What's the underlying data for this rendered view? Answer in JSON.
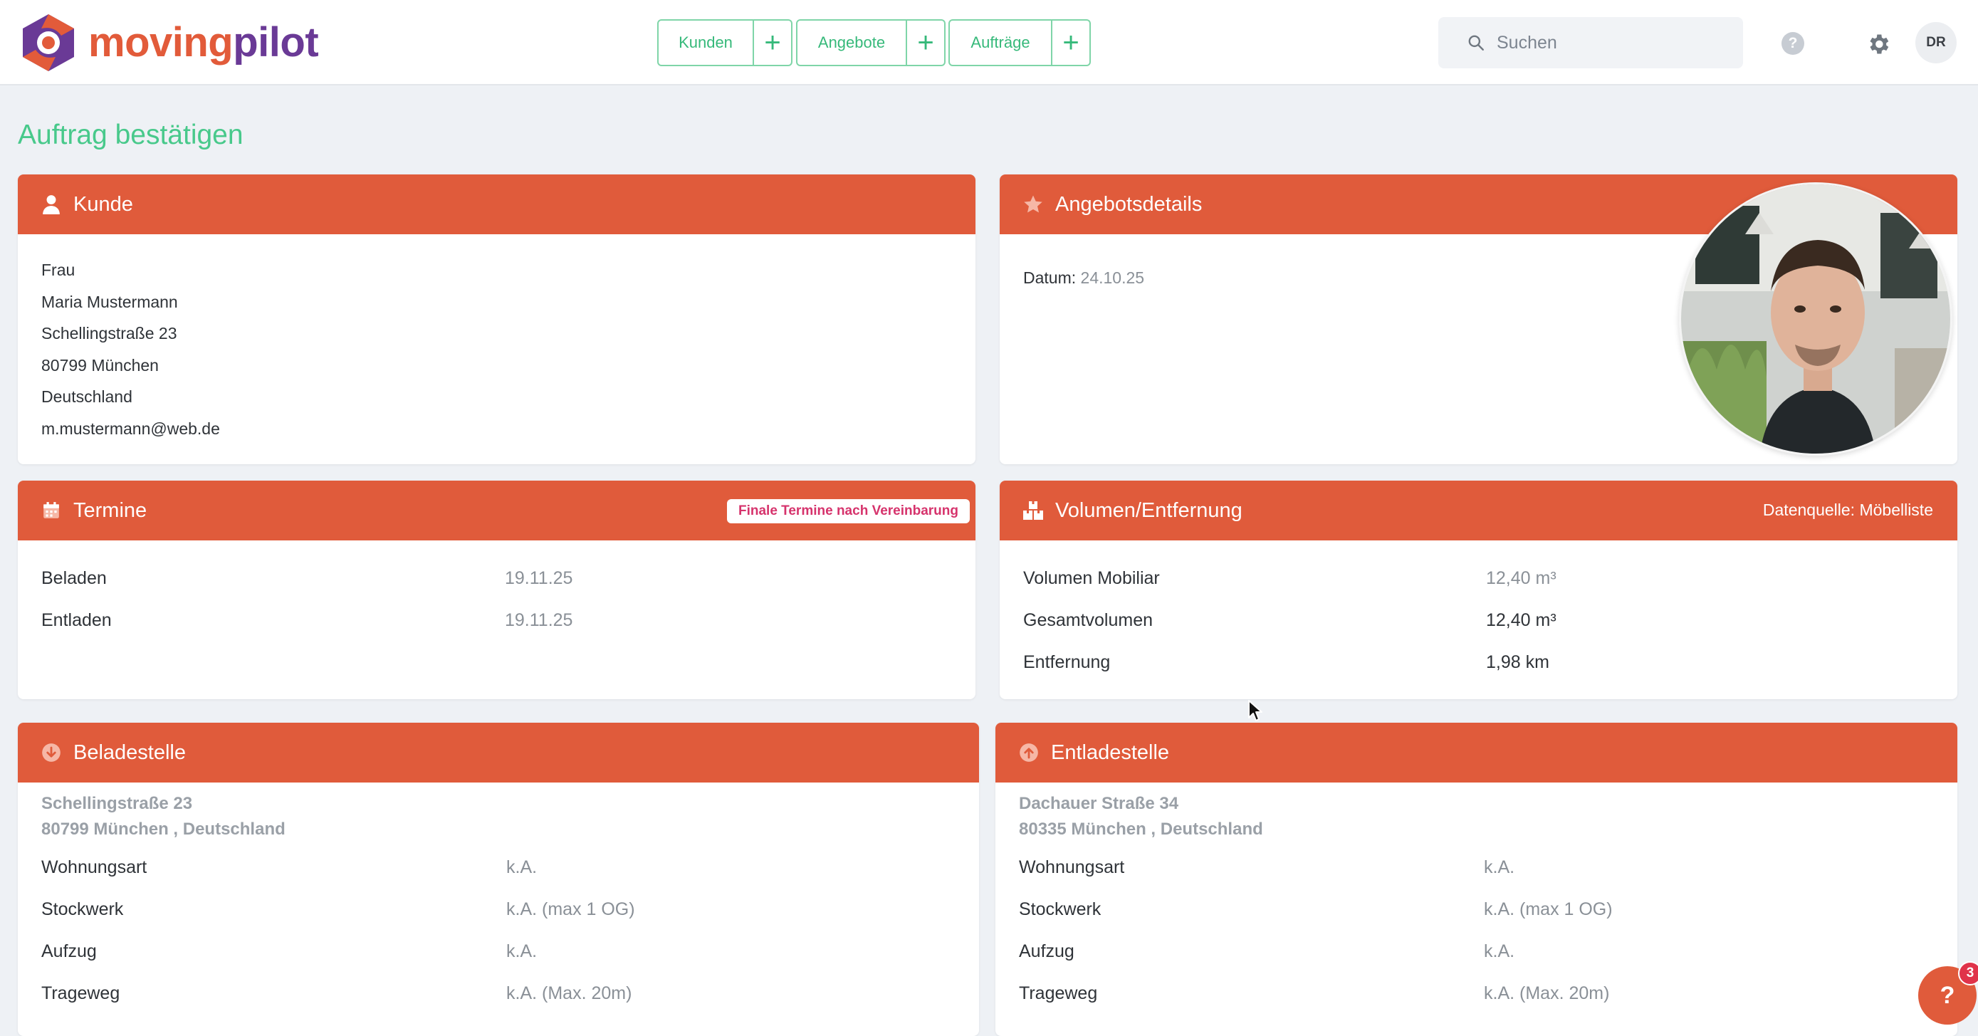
{
  "brand": {
    "part1": "moving",
    "part2": "pilot"
  },
  "nav": [
    {
      "label": "Kunden",
      "plus": "+"
    },
    {
      "label": "Angebote",
      "plus": "+"
    },
    {
      "label": "Aufträge",
      "plus": "+"
    }
  ],
  "search": {
    "placeholder": "Suchen"
  },
  "help_label": "?",
  "user": {
    "initials": "DR"
  },
  "page_title": "Auftrag bestätigen",
  "kunde": {
    "title": "Kunde",
    "lines": [
      "Frau",
      "Maria Mustermann",
      "Schellingstraße 23",
      "80799 München",
      "Deutschland",
      "m.mustermann@web.de"
    ]
  },
  "angebot": {
    "title": "Angebotsdetails",
    "date_label": "Datum:",
    "date_value": "24.10.25"
  },
  "termine": {
    "title": "Termine",
    "badge": "Finale Termine nach Vereinbarung",
    "rows": [
      {
        "label": "Beladen",
        "value": "19.11.25"
      },
      {
        "label": "Entladen",
        "value": "19.11.25"
      }
    ]
  },
  "volumen": {
    "title": "Volumen/Entfernung",
    "source": "Datenquelle: Möbelliste",
    "rows": [
      {
        "label": "Volumen Mobiliar",
        "value": "12,40 m³"
      },
      {
        "label": "Gesamtvolumen",
        "value": "12,40 m³"
      },
      {
        "label": "Entfernung",
        "value": "1,98 km"
      }
    ]
  },
  "beladestelle": {
    "title": "Beladestelle",
    "street": "Schellingstraße 23",
    "city": "80799 München , Deutschland",
    "rows": [
      {
        "label": "Wohnungsart",
        "value": "k.A."
      },
      {
        "label": "Stockwerk",
        "value": "k.A. (max 1 OG)"
      },
      {
        "label": "Aufzug",
        "value": "k.A."
      },
      {
        "label": "Trageweg",
        "value": "k.A. (Max. 20m)"
      }
    ]
  },
  "entladestelle": {
    "title": "Entladestelle",
    "street": "Dachauer Straße 34",
    "city": "80335 München , Deutschland",
    "rows": [
      {
        "label": "Wohnungsart",
        "value": "k.A."
      },
      {
        "label": "Stockwerk",
        "value": "k.A. (max 1 OG)"
      },
      {
        "label": "Aufzug",
        "value": "k.A."
      },
      {
        "label": "Trageweg",
        "value": "k.A. (Max. 20m)"
      }
    ]
  },
  "chat": {
    "label": "?",
    "badge": "3"
  },
  "colors": {
    "accent": "#e05b3b",
    "green": "#48c98b",
    "brand_purple": "#6a3a96"
  },
  "icons": [
    "search-icon",
    "help-icon",
    "gear-icon",
    "user-icon",
    "star-icon",
    "calendar-icon",
    "boxes-icon",
    "arrow-down-circle-icon",
    "arrow-up-circle-icon"
  ]
}
